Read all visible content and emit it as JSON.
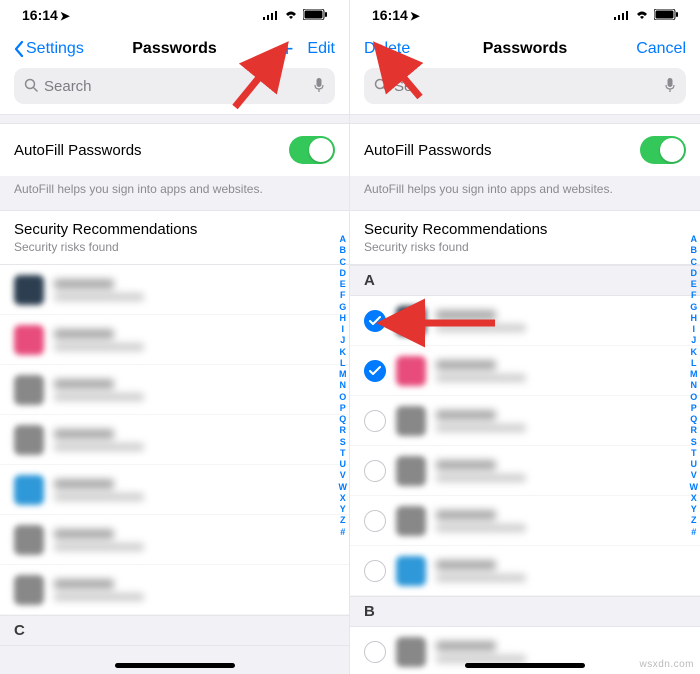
{
  "watermark": "wsxdn.com",
  "status": {
    "time": "16:14",
    "loc_icon": "➤"
  },
  "az_index": [
    "A",
    "B",
    "C",
    "D",
    "E",
    "F",
    "G",
    "H",
    "I",
    "J",
    "K",
    "L",
    "M",
    "N",
    "O",
    "P",
    "Q",
    "R",
    "S",
    "T",
    "U",
    "V",
    "W",
    "X",
    "Y",
    "Z",
    "#"
  ],
  "left": {
    "nav": {
      "back": "Settings",
      "title": "Passwords",
      "edit": "Edit",
      "plus": "+"
    },
    "search_placeholder": "Search",
    "autofill": {
      "label": "AutoFill Passwords",
      "on": true,
      "caption": "AutoFill helps you sign into apps and websites."
    },
    "secrec": {
      "title": "Security Recommendations",
      "sub": "Security risks found"
    },
    "sections": [
      {
        "header": "",
        "items": [
          {
            "av": "av1"
          },
          {
            "av": "av2"
          },
          {
            "av": "av3"
          },
          {
            "av": "av3"
          },
          {
            "av": "av4"
          }
        ]
      },
      {
        "header": "",
        "items": [
          {
            "av": "av3"
          },
          {
            "av": "av3"
          }
        ]
      },
      {
        "header": "C",
        "items": []
      }
    ]
  },
  "right": {
    "nav": {
      "delete": "Delete",
      "title": "Passwords",
      "cancel": "Cancel"
    },
    "search_placeholder": "Se",
    "autofill": {
      "label": "AutoFill Passwords",
      "on": true,
      "caption": "AutoFill helps you sign into apps and websites."
    },
    "secrec": {
      "title": "Security Recommendations",
      "sub": "Security risks found"
    },
    "sections": [
      {
        "header": "A",
        "items": [
          {
            "av": "av1",
            "checked": true
          },
          {
            "av": "av2",
            "checked": true
          },
          {
            "av": "av3",
            "checked": false
          },
          {
            "av": "av3",
            "checked": false
          },
          {
            "av": "av3",
            "checked": false
          },
          {
            "av": "av4",
            "checked": false
          }
        ]
      },
      {
        "header": "B",
        "items": [
          {
            "av": "av3",
            "checked": false
          }
        ]
      }
    ]
  },
  "arrow_color": "#e3342f"
}
